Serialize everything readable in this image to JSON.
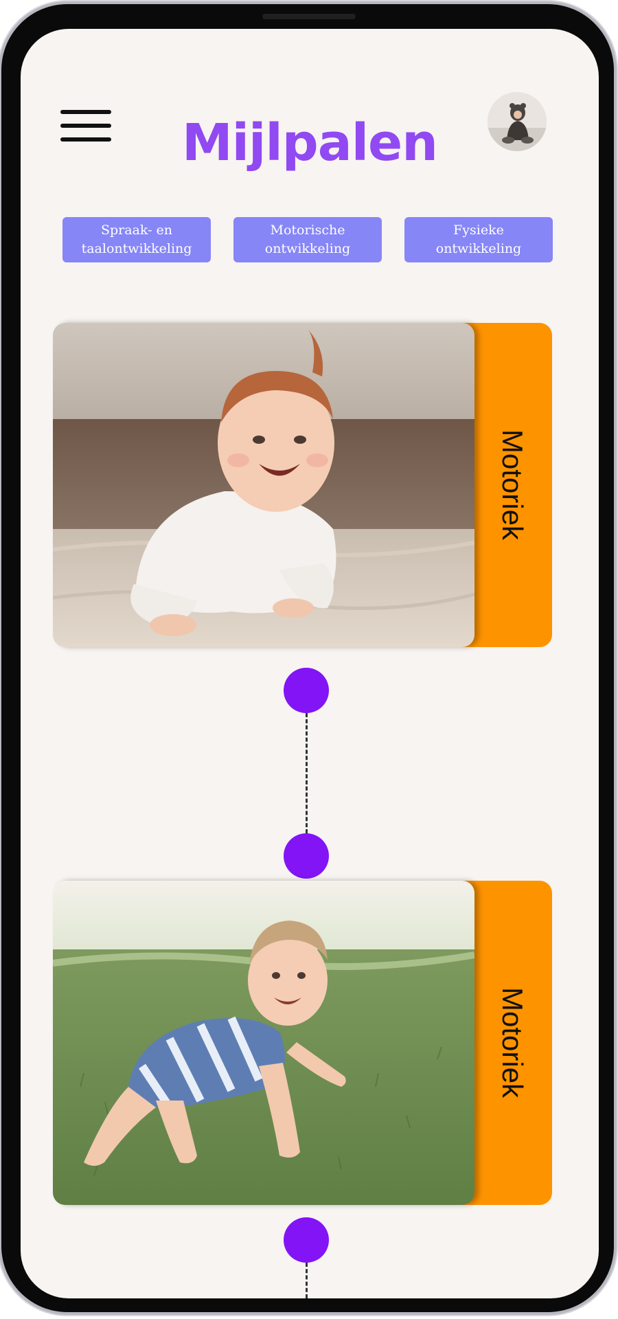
{
  "header": {
    "title": "Mijlpalen",
    "menu_icon": "hamburger-menu-icon",
    "avatar": "profile-avatar"
  },
  "filters": [
    {
      "label": "Spraak- en\ntaalontwikkeling"
    },
    {
      "label": "Motorische\nontwikkeling"
    },
    {
      "label": "Fysieke\nontwikkeling"
    }
  ],
  "milestones": [
    {
      "category": "Motoriek",
      "photo": "baby lying on tummy smiling"
    },
    {
      "category": "Motoriek",
      "photo": "baby crawling on grass"
    }
  ],
  "colors": {
    "background": "#f8f4f1",
    "title": "#9149f2",
    "chip": "#8686f7",
    "tab": "#fe9300",
    "timeline_dot": "#8214f6"
  }
}
